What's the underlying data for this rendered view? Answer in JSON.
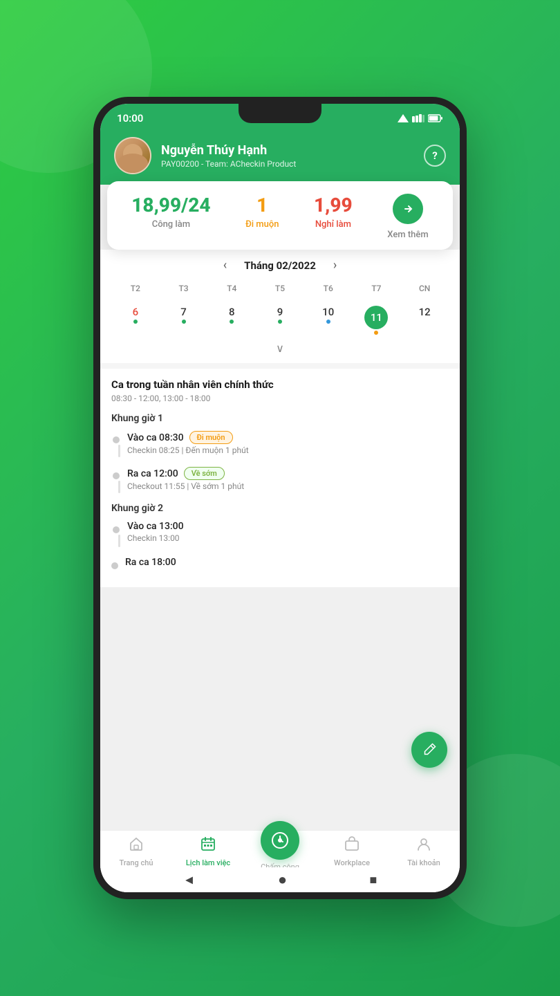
{
  "app": {
    "status_bar": {
      "time": "10:00",
      "icons": "▲▼🔋"
    },
    "header": {
      "user_name": "Nguyễn Thúy Hạnh",
      "user_sub": "PAY00200 - Team: ACheckin Product",
      "help_icon": "?"
    },
    "stats": {
      "cong_lam_value": "18,99/24",
      "cong_lam_label": "Công làm",
      "di_muon_value": "1",
      "di_muon_label": "Đi muộn",
      "nghi_lam_value": "1,99",
      "nghi_lam_label": "Nghỉ làm",
      "xem_them_label": "Xem thêm",
      "arrow": "→"
    },
    "calendar": {
      "title": "Tháng 02/2022",
      "nav_prev": "‹",
      "nav_next": "›",
      "day_headers": [
        "T2",
        "T3",
        "T4",
        "T5",
        "T6",
        "T7",
        "CN"
      ],
      "days": [
        {
          "num": "6",
          "red": true,
          "dot": "green"
        },
        {
          "num": "7",
          "dot": "green"
        },
        {
          "num": "8",
          "dot": "green"
        },
        {
          "num": "9",
          "dot": "green"
        },
        {
          "num": "10",
          "dot": "blue"
        },
        {
          "num": "11",
          "selected": true,
          "dot": "orange"
        },
        {
          "num": "12"
        }
      ],
      "expand_icon": "∨"
    },
    "schedule": {
      "title": "Ca trong tuần nhân viên chính thức",
      "time_range": "08:30 - 12:00, 13:00 - 18:00",
      "shifts": [
        {
          "label": "Khung giờ 1",
          "items": [
            {
              "title": "Vào ca 08:30",
              "badge": "Đi muộn",
              "badge_type": "orange",
              "detail": "Checkin 08:25 | Đến muộn 1 phút"
            },
            {
              "title": "Ra ca 12:00",
              "badge": "Về sớm",
              "badge_type": "green",
              "detail": "Checkout 11:55 | Về sớm 1 phút"
            }
          ]
        },
        {
          "label": "Khung giờ 2",
          "items": [
            {
              "title": "Vào ca 13:00",
              "badge": "",
              "detail": "Checkin 13:00"
            },
            {
              "title": "Ra ca 18:00",
              "badge": "",
              "detail": ""
            }
          ]
        }
      ]
    },
    "bottom_nav": {
      "items": [
        {
          "label": "Trang chủ",
          "icon": "⌂",
          "active": false
        },
        {
          "label": "Lịch làm việc",
          "icon": "▦",
          "active": true
        },
        {
          "label": "Chấm công",
          "icon": "◎",
          "fab": true,
          "active": false
        },
        {
          "label": "Workplace",
          "icon": "▭",
          "active": false
        },
        {
          "label": "Tài khoản",
          "icon": "👤",
          "active": false
        }
      ]
    },
    "system_nav": {
      "back": "◄",
      "home": "●",
      "recent": "■"
    }
  }
}
